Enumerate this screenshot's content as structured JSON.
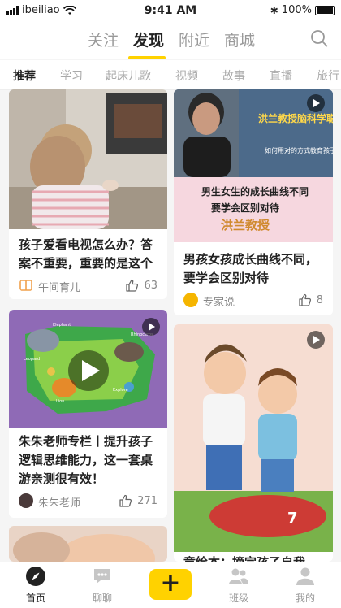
{
  "status": {
    "carrier": "ibeiliao",
    "time": "9:41 AM",
    "battery": "100%"
  },
  "top_tabs": [
    {
      "label": "关注",
      "active": false
    },
    {
      "label": "发现",
      "active": true
    },
    {
      "label": "附近",
      "active": false
    },
    {
      "label": "商城",
      "active": false
    }
  ],
  "categories": [
    {
      "label": "推荐",
      "active": true
    },
    {
      "label": "学习",
      "active": false
    },
    {
      "label": "起床儿歌",
      "active": false
    },
    {
      "label": "视频",
      "active": false
    },
    {
      "label": "故事",
      "active": false
    },
    {
      "label": "直播",
      "active": false
    },
    {
      "label": "旅行",
      "active": false
    }
  ],
  "cards": [
    {
      "title": "孩子爱看电视怎么办？答案不重要，重要的是这个",
      "author": "午间育儿",
      "likes": "63",
      "has_video": false
    },
    {
      "title": "男孩女孩成长曲线不同，要学会区别对待",
      "author": "专家说",
      "likes": "8",
      "has_video": true,
      "thumb_text": {
        "headline": "洪兰教授脑科学聪明育儿法",
        "sub": "如何用对的方式教育孩子",
        "line1": "男生女生的成长曲线不同",
        "line2": "要学会区别对待",
        "signature": "洪兰教授"
      }
    },
    {
      "title": "朱朱老师专栏丨提升孩子逻辑思维能力，这一套桌游亲测很有效！",
      "author": "朱朱老师",
      "likes": "271",
      "has_video": true,
      "map_labels": [
        "Elephant",
        "Leopard",
        "Rhinoceros",
        "Lion",
        "Explore"
      ]
    },
    {
      "title": "童绘本：摘完孩子自我",
      "author": "",
      "likes": "",
      "has_video": true
    }
  ],
  "bottom_tabs": [
    {
      "label": "首页",
      "icon": "compass-icon",
      "active": true
    },
    {
      "label": "聊聊",
      "icon": "chat-icon",
      "active": false
    },
    {
      "label": "+",
      "icon": "plus-icon",
      "active": false
    },
    {
      "label": "班级",
      "icon": "group-icon",
      "active": false
    },
    {
      "label": "我的",
      "icon": "profile-icon",
      "active": false
    }
  ],
  "colors": {
    "accent": "#ffd200",
    "background": "#f5f5f5"
  }
}
